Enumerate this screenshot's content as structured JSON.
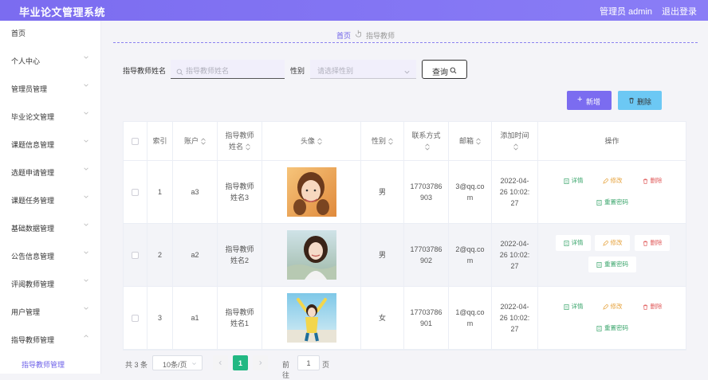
{
  "app": {
    "title": "毕业论文管理系统",
    "admin_label": "管理员 admin",
    "logout_label": "退出登录"
  },
  "sidebar": {
    "items": [
      {
        "label": "首页",
        "has_arrow": false
      },
      {
        "label": "个人中心",
        "has_arrow": true
      },
      {
        "label": "管理员管理",
        "has_arrow": true
      },
      {
        "label": "毕业论文管理",
        "has_arrow": true
      },
      {
        "label": "课题信息管理",
        "has_arrow": true
      },
      {
        "label": "选题申请管理",
        "has_arrow": true
      },
      {
        "label": "课题任务管理",
        "has_arrow": true
      },
      {
        "label": "基础数据管理",
        "has_arrow": true
      },
      {
        "label": "公告信息管理",
        "has_arrow": true
      },
      {
        "label": "评阅教师管理",
        "has_arrow": true
      },
      {
        "label": "用户管理",
        "has_arrow": true
      },
      {
        "label": "指导教师管理",
        "has_arrow": true,
        "expanded": true
      }
    ],
    "active_sub": "指导教师管理"
  },
  "breadcrumb": {
    "home": "首页",
    "current": "指导教师"
  },
  "search": {
    "name_label": "指导教师姓名",
    "name_placeholder": "指导教师姓名",
    "gender_label": "性别",
    "gender_placeholder": "请选择性别",
    "query_label": "查询"
  },
  "actions": {
    "add_label": "新增",
    "delete_label": "删除"
  },
  "table": {
    "headers": {
      "index": "索引",
      "account": "账户",
      "name_line1": "指导教师",
      "name_line2": "姓名",
      "avatar": "头像",
      "gender": "性别",
      "contact_line1": "联系方式",
      "email": "邮箱",
      "added_line1": "添加时间",
      "ops": "操作"
    },
    "rows": [
      {
        "index": "1",
        "account": "a3",
        "name_l1": "指导教师",
        "name_l2": "姓名3",
        "gender": "男",
        "phone_l1": "17703786",
        "phone_l2": "903",
        "email_l1": "3@qq.co",
        "email_l2": "m",
        "time_l1": "2022-04-",
        "time_l2": "26 10:02:",
        "time_l3": "27"
      },
      {
        "index": "2",
        "account": "a2",
        "name_l1": "指导教师",
        "name_l2": "姓名2",
        "gender": "男",
        "phone_l1": "17703786",
        "phone_l2": "902",
        "email_l1": "2@qq.co",
        "email_l2": "m",
        "time_l1": "2022-04-",
        "time_l2": "26 10:02:",
        "time_l3": "27"
      },
      {
        "index": "3",
        "account": "a1",
        "name_l1": "指导教师",
        "name_l2": "姓名1",
        "gender": "女",
        "phone_l1": "17703786",
        "phone_l2": "901",
        "email_l1": "1@qq.co",
        "email_l2": "m",
        "time_l1": "2022-04-",
        "time_l2": "26 10:02:",
        "time_l3": "27"
      }
    ],
    "op_labels": {
      "detail": "详情",
      "edit": "修改",
      "delete": "删除",
      "reset": "重置密码"
    }
  },
  "pager": {
    "total": "共 3 条",
    "page_size": "10条/页",
    "current_page": "1",
    "goto_label": "前往",
    "goto_value": "1",
    "goto_unit": "页"
  },
  "colors": {
    "brand": "#7b6cf0",
    "delete_btn": "#6cc8f4",
    "pager_active": "#22b883",
    "detail": "#3aa56b",
    "edit": "#e6a23c",
    "danger": "#e05a5a"
  }
}
